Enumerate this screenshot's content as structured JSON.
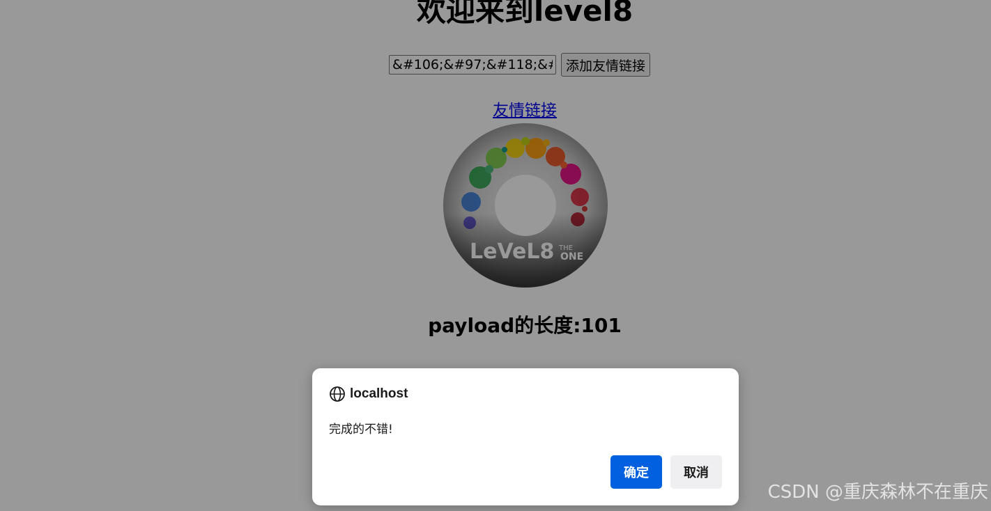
{
  "page": {
    "heading": "欢迎来到level8",
    "keyword_value": "&#106;&#97;&#118;&#97;",
    "add_button_label": "添加友情链接",
    "friend_link_label": "友情链接",
    "disc_image_label": "LeVeL8 THE ONE",
    "payload_length_text": "payload的长度:101"
  },
  "dialog": {
    "origin": "localhost",
    "origin_icon": "globe-icon",
    "message": "完成的不错!",
    "ok_label": "确定",
    "cancel_label": "取消",
    "ok_color": "#0060df"
  },
  "watermark": {
    "text": "CSDN @重庆森林不在重庆"
  }
}
